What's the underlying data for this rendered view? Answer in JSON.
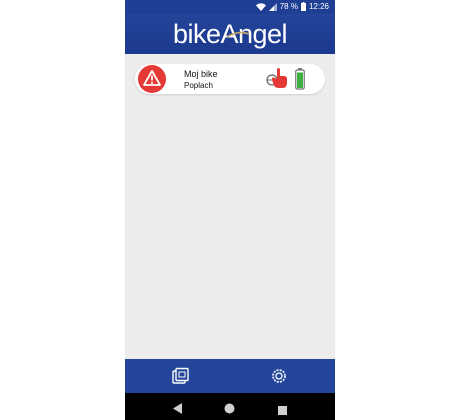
{
  "statusbar": {
    "battery_percent": "78 %",
    "time": "12:26",
    "icons": [
      "wifi-icon",
      "cell-signal-icon",
      "battery-icon"
    ]
  },
  "header": {
    "logo_part1": "bike",
    "logo_part2": "Angel"
  },
  "devices": [
    {
      "name": "Moj bike",
      "status": "Poplach",
      "alarm_color": "#e53935",
      "battery_color": "#3cb043",
      "icons": [
        "alarm-warning-icon",
        "lock-icon",
        "hand-touch-icon",
        "battery-icon"
      ]
    }
  ],
  "bottom_nav": {
    "items": [
      "devices-icon",
      "settings-gear-icon"
    ]
  },
  "system_nav": {
    "items": [
      "back-icon",
      "home-icon",
      "recents-icon"
    ]
  },
  "colors": {
    "brand_blue": "#1f4196",
    "background": "#ececec",
    "alarm_red": "#e53935"
  }
}
